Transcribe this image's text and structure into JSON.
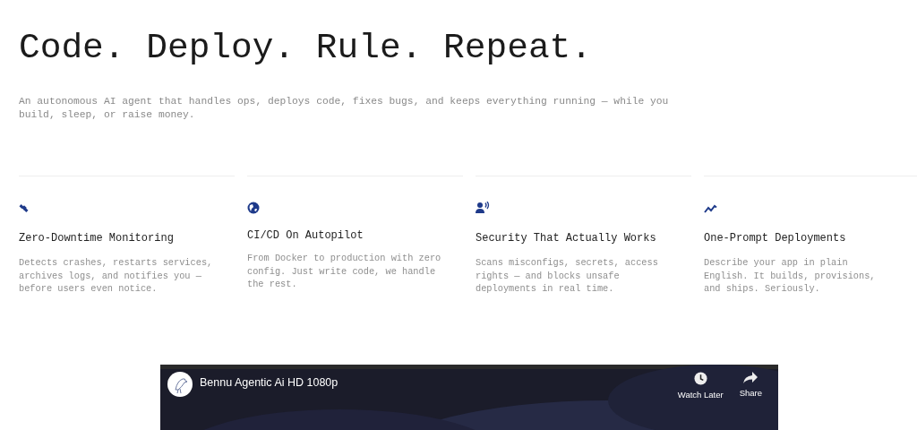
{
  "hero": {
    "title": "Code. Deploy. Rule. Repeat.",
    "subtitle": "An autonomous AI agent that handles ops, deploys code, fixes bugs, and keeps everything running — while you build, sleep, or raise money."
  },
  "features": [
    {
      "kind": "monitoring",
      "title": "Zero-Downtime Monitoring",
      "text": "Detects crashes, restarts services, archives logs, and notifies you — before users even notice."
    },
    {
      "kind": "globe",
      "title": "CI/CD On Autopilot",
      "text": "From Docker to production with zero config. Just write code, we handle the rest."
    },
    {
      "kind": "security",
      "title": "Security That Actually Works",
      "text": "Scans misconfigs, secrets, access rights — and blocks unsafe deployments in real time."
    },
    {
      "kind": "trend",
      "title": "One-Prompt Deployments",
      "text": "Describe your app in plain English. It builds, provisions, and ships. Seriously."
    }
  ],
  "video": {
    "kind": "picture",
    "title": "Bennu Agentic Ai HD 1080p",
    "actions": [
      {
        "kind": "watch_later",
        "label": "Watch Later"
      },
      {
        "kind": "share",
        "label": "Share"
      }
    ]
  }
}
